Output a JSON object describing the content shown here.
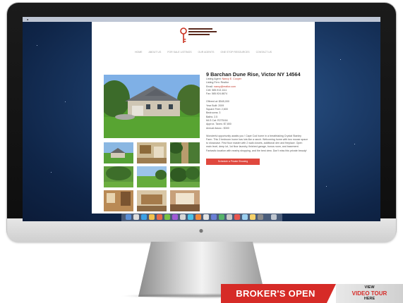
{
  "listing_page": {
    "nav_items": [
      "HOME",
      "ABOUT US",
      "FOR SALE LISTINGS",
      "OUR AGENTS",
      "ONE STOP RESOURCES",
      "CONTACT US"
    ],
    "address": "9 Barchan Dune Rise, Victor NY 14564",
    "contact_lines": [
      {
        "label": "Listing Agent: ",
        "value": "Nancy E. Cooper"
      },
      {
        "label": "Listing Firm: ",
        "value": "Realtor"
      },
      {
        "label": "Email: ",
        "value": "nancy@realtor.com"
      },
      {
        "label": "Cell: ",
        "value": "585.913.1111"
      },
      {
        "label": "Fax: ",
        "value": "585.924.8874"
      }
    ],
    "detail_lines": [
      {
        "label": "Offered at: ",
        "value": "$545,000"
      },
      {
        "label": "Year Built: ",
        "value": "2009"
      },
      {
        "label": "Square Feet: ",
        "value": "2,600"
      },
      {
        "label": "Bedrooms: ",
        "value": "3"
      },
      {
        "label": "Baths: ",
        "value": "2.5"
      },
      {
        "label": "MLS Cat: ",
        "value": "R275164"
      },
      {
        "label": "Approx. Taxes: ",
        "value": "$7,800"
      },
      {
        "label": "Annual Assoc.: ",
        "value": "$300"
      }
    ],
    "description": "Wonderful opportunity awaits you ! Cape Cod home in a breathtaking Crystal Stanley Farm. This 3 bedroom home has lots like a ranch. Welcoming home with two mouse space to showcase. First floor master with 2 walk closets, additional den and fireplace. Open main level, deep lot, 1st floor laundry, finished garage, bonus room, and basement. Fantastic location with nearby shopping, and the best view. Don't miss this private beauty!",
    "cta": "Schedule a Private Showing"
  },
  "banner": {
    "broker_open": "BROKER'S OPEN",
    "view": "VIEW",
    "video_tour": "VIDEO TOUR",
    "here": "HERE"
  },
  "colors": {
    "accent_red": "#d62b27",
    "link_red": "#c0392b",
    "desktop_blue": "#1c3c69"
  }
}
